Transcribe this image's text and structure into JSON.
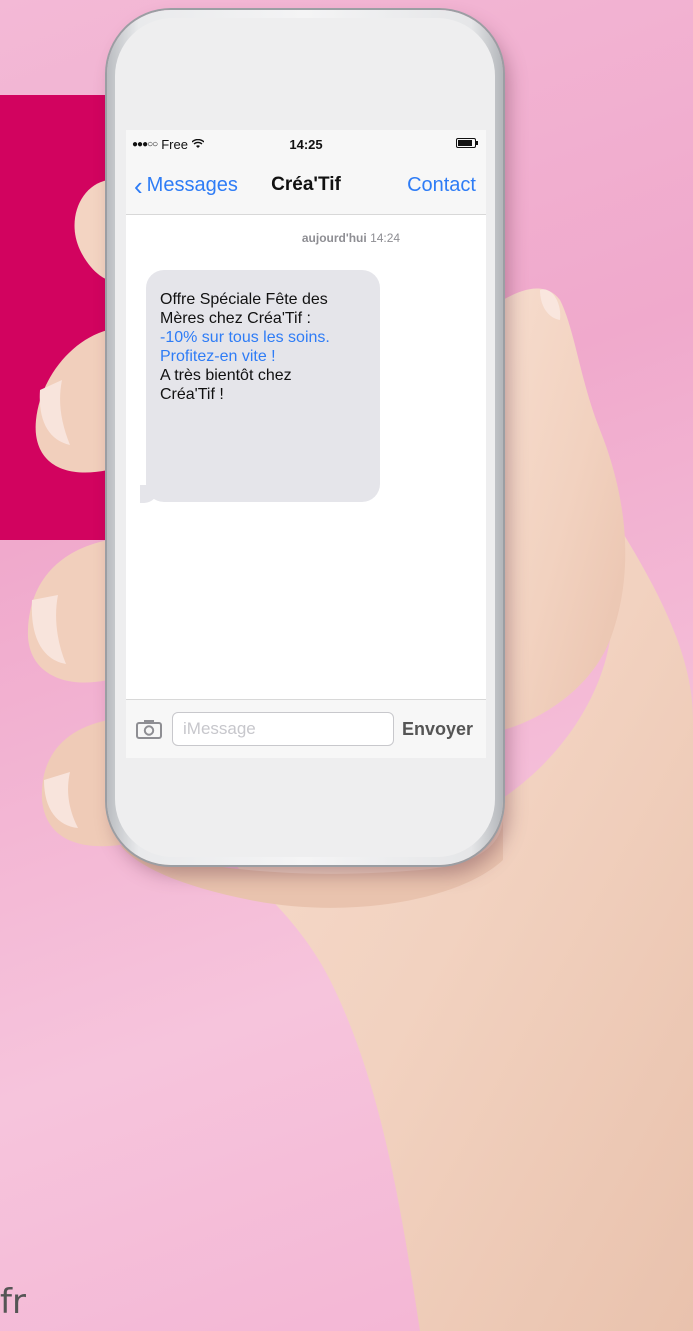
{
  "background": {
    "color": "#f3b9d6",
    "panel_color": "#d2035f",
    "footer_text": "fr"
  },
  "status": {
    "carrier": "Free",
    "time": "14:25"
  },
  "nav": {
    "back_label": "Messages",
    "title": "Créa'Tif",
    "contact_label": "Contact"
  },
  "thread": {
    "timestamp_day": "aujourd'hui",
    "timestamp_time": "14:24",
    "message": {
      "line1": "Offre Spéciale Fête des",
      "line2": "Mères chez Créa'Tif :",
      "line3": "-10% sur tous les soins.",
      "line4": "Profitez-en vite !",
      "line5": "A très bientôt chez",
      "line6": "Créa'Tif !"
    }
  },
  "composer": {
    "placeholder": "iMessage",
    "send_label": "Envoyer"
  },
  "colors": {
    "accent": "#2e7cf6",
    "bubble": "#e5e5ea"
  }
}
